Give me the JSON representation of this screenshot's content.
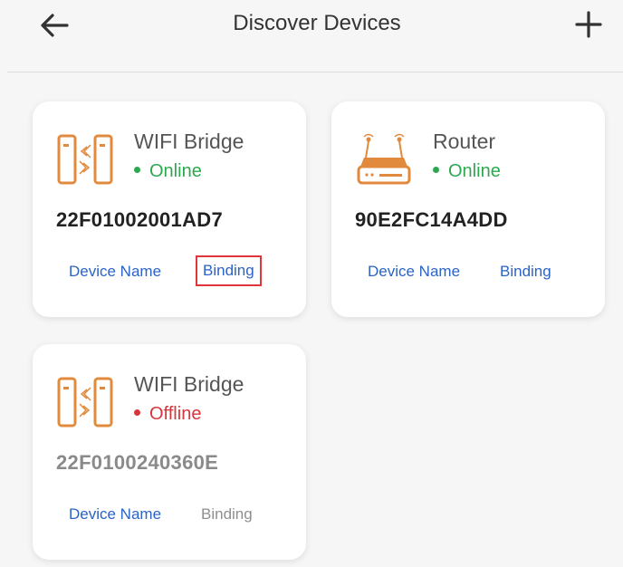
{
  "header": {
    "title": "Discover Devices",
    "back_icon": "arrow-left-icon",
    "add_icon": "plus-icon"
  },
  "colors": {
    "online": "#2ea84f",
    "offline": "#d6363a",
    "link": "#2b63c6",
    "disabled": "#8f8f8f",
    "icon_orange": "#e18a3d",
    "highlight_border": "#e0353b"
  },
  "devices": [
    {
      "name": "WIFI Bridge",
      "type_icon": "wifi-bridge-icon",
      "status": "Online",
      "mac": "22F01002001AD7",
      "action_name": "Device Name",
      "action_binding": "Binding"
    },
    {
      "name": "Router",
      "type_icon": "router-icon",
      "status": "Online",
      "mac": "90E2FC14A4DD",
      "action_name": "Device Name",
      "action_binding": "Binding"
    },
    {
      "name": "WIFI Bridge",
      "type_icon": "wifi-bridge-icon",
      "status": "Offline",
      "mac": "22F0100240360E",
      "action_name": "Device Name",
      "action_binding": "Binding"
    }
  ]
}
